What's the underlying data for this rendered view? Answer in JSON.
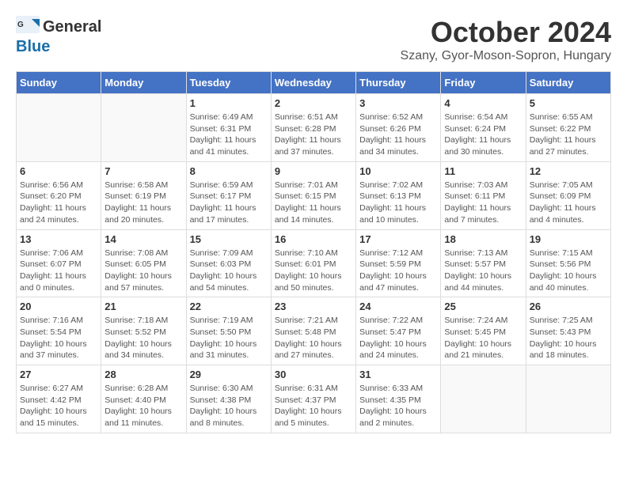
{
  "header": {
    "logo_general": "General",
    "logo_blue": "Blue",
    "month": "October 2024",
    "location": "Szany, Gyor-Moson-Sopron, Hungary"
  },
  "weekdays": [
    "Sunday",
    "Monday",
    "Tuesday",
    "Wednesday",
    "Thursday",
    "Friday",
    "Saturday"
  ],
  "weeks": [
    [
      {
        "day": "",
        "sunrise": "",
        "sunset": "",
        "daylight": ""
      },
      {
        "day": "",
        "sunrise": "",
        "sunset": "",
        "daylight": ""
      },
      {
        "day": "1",
        "sunrise": "Sunrise: 6:49 AM",
        "sunset": "Sunset: 6:31 PM",
        "daylight": "Daylight: 11 hours and 41 minutes."
      },
      {
        "day": "2",
        "sunrise": "Sunrise: 6:51 AM",
        "sunset": "Sunset: 6:28 PM",
        "daylight": "Daylight: 11 hours and 37 minutes."
      },
      {
        "day": "3",
        "sunrise": "Sunrise: 6:52 AM",
        "sunset": "Sunset: 6:26 PM",
        "daylight": "Daylight: 11 hours and 34 minutes."
      },
      {
        "day": "4",
        "sunrise": "Sunrise: 6:54 AM",
        "sunset": "Sunset: 6:24 PM",
        "daylight": "Daylight: 11 hours and 30 minutes."
      },
      {
        "day": "5",
        "sunrise": "Sunrise: 6:55 AM",
        "sunset": "Sunset: 6:22 PM",
        "daylight": "Daylight: 11 hours and 27 minutes."
      }
    ],
    [
      {
        "day": "6",
        "sunrise": "Sunrise: 6:56 AM",
        "sunset": "Sunset: 6:20 PM",
        "daylight": "Daylight: 11 hours and 24 minutes."
      },
      {
        "day": "7",
        "sunrise": "Sunrise: 6:58 AM",
        "sunset": "Sunset: 6:19 PM",
        "daylight": "Daylight: 11 hours and 20 minutes."
      },
      {
        "day": "8",
        "sunrise": "Sunrise: 6:59 AM",
        "sunset": "Sunset: 6:17 PM",
        "daylight": "Daylight: 11 hours and 17 minutes."
      },
      {
        "day": "9",
        "sunrise": "Sunrise: 7:01 AM",
        "sunset": "Sunset: 6:15 PM",
        "daylight": "Daylight: 11 hours and 14 minutes."
      },
      {
        "day": "10",
        "sunrise": "Sunrise: 7:02 AM",
        "sunset": "Sunset: 6:13 PM",
        "daylight": "Daylight: 11 hours and 10 minutes."
      },
      {
        "day": "11",
        "sunrise": "Sunrise: 7:03 AM",
        "sunset": "Sunset: 6:11 PM",
        "daylight": "Daylight: 11 hours and 7 minutes."
      },
      {
        "day": "12",
        "sunrise": "Sunrise: 7:05 AM",
        "sunset": "Sunset: 6:09 PM",
        "daylight": "Daylight: 11 hours and 4 minutes."
      }
    ],
    [
      {
        "day": "13",
        "sunrise": "Sunrise: 7:06 AM",
        "sunset": "Sunset: 6:07 PM",
        "daylight": "Daylight: 11 hours and 0 minutes."
      },
      {
        "day": "14",
        "sunrise": "Sunrise: 7:08 AM",
        "sunset": "Sunset: 6:05 PM",
        "daylight": "Daylight: 10 hours and 57 minutes."
      },
      {
        "day": "15",
        "sunrise": "Sunrise: 7:09 AM",
        "sunset": "Sunset: 6:03 PM",
        "daylight": "Daylight: 10 hours and 54 minutes."
      },
      {
        "day": "16",
        "sunrise": "Sunrise: 7:10 AM",
        "sunset": "Sunset: 6:01 PM",
        "daylight": "Daylight: 10 hours and 50 minutes."
      },
      {
        "day": "17",
        "sunrise": "Sunrise: 7:12 AM",
        "sunset": "Sunset: 5:59 PM",
        "daylight": "Daylight: 10 hours and 47 minutes."
      },
      {
        "day": "18",
        "sunrise": "Sunrise: 7:13 AM",
        "sunset": "Sunset: 5:57 PM",
        "daylight": "Daylight: 10 hours and 44 minutes."
      },
      {
        "day": "19",
        "sunrise": "Sunrise: 7:15 AM",
        "sunset": "Sunset: 5:56 PM",
        "daylight": "Daylight: 10 hours and 40 minutes."
      }
    ],
    [
      {
        "day": "20",
        "sunrise": "Sunrise: 7:16 AM",
        "sunset": "Sunset: 5:54 PM",
        "daylight": "Daylight: 10 hours and 37 minutes."
      },
      {
        "day": "21",
        "sunrise": "Sunrise: 7:18 AM",
        "sunset": "Sunset: 5:52 PM",
        "daylight": "Daylight: 10 hours and 34 minutes."
      },
      {
        "day": "22",
        "sunrise": "Sunrise: 7:19 AM",
        "sunset": "Sunset: 5:50 PM",
        "daylight": "Daylight: 10 hours and 31 minutes."
      },
      {
        "day": "23",
        "sunrise": "Sunrise: 7:21 AM",
        "sunset": "Sunset: 5:48 PM",
        "daylight": "Daylight: 10 hours and 27 minutes."
      },
      {
        "day": "24",
        "sunrise": "Sunrise: 7:22 AM",
        "sunset": "Sunset: 5:47 PM",
        "daylight": "Daylight: 10 hours and 24 minutes."
      },
      {
        "day": "25",
        "sunrise": "Sunrise: 7:24 AM",
        "sunset": "Sunset: 5:45 PM",
        "daylight": "Daylight: 10 hours and 21 minutes."
      },
      {
        "day": "26",
        "sunrise": "Sunrise: 7:25 AM",
        "sunset": "Sunset: 5:43 PM",
        "daylight": "Daylight: 10 hours and 18 minutes."
      }
    ],
    [
      {
        "day": "27",
        "sunrise": "Sunrise: 6:27 AM",
        "sunset": "Sunset: 4:42 PM",
        "daylight": "Daylight: 10 hours and 15 minutes."
      },
      {
        "day": "28",
        "sunrise": "Sunrise: 6:28 AM",
        "sunset": "Sunset: 4:40 PM",
        "daylight": "Daylight: 10 hours and 11 minutes."
      },
      {
        "day": "29",
        "sunrise": "Sunrise: 6:30 AM",
        "sunset": "Sunset: 4:38 PM",
        "daylight": "Daylight: 10 hours and 8 minutes."
      },
      {
        "day": "30",
        "sunrise": "Sunrise: 6:31 AM",
        "sunset": "Sunset: 4:37 PM",
        "daylight": "Daylight: 10 hours and 5 minutes."
      },
      {
        "day": "31",
        "sunrise": "Sunrise: 6:33 AM",
        "sunset": "Sunset: 4:35 PM",
        "daylight": "Daylight: 10 hours and 2 minutes."
      },
      {
        "day": "",
        "sunrise": "",
        "sunset": "",
        "daylight": ""
      },
      {
        "day": "",
        "sunrise": "",
        "sunset": "",
        "daylight": ""
      }
    ]
  ]
}
